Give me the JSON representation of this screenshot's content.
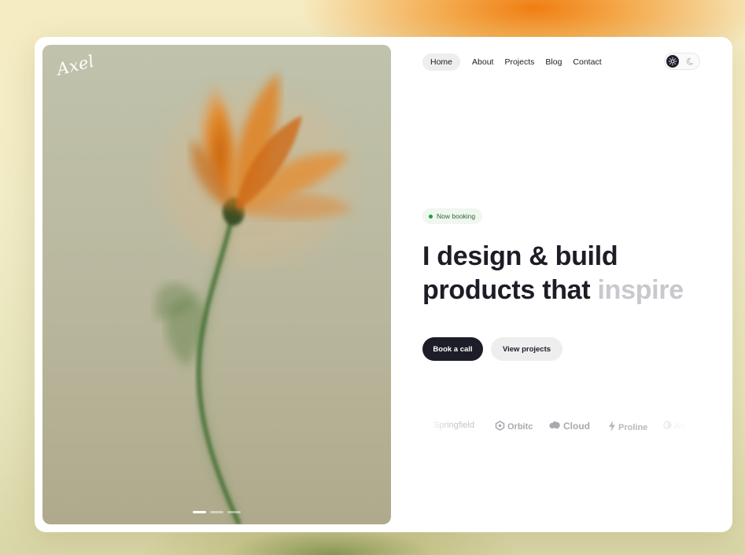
{
  "brand": {
    "logo_text": "Axel"
  },
  "nav": {
    "items": [
      {
        "label": "Home",
        "active": true
      },
      {
        "label": "About",
        "active": false
      },
      {
        "label": "Projects",
        "active": false
      },
      {
        "label": "Blog",
        "active": false
      },
      {
        "label": "Contact",
        "active": false
      }
    ]
  },
  "theme_toggle": {
    "selected": "light",
    "options": [
      "sun-icon",
      "moon-icon"
    ]
  },
  "status_badge": {
    "label": "Now booking",
    "color": "#1aa13a"
  },
  "hero": {
    "headline_line1": "I design & build",
    "headline_line2_dark": "products that",
    "headline_line2_muted": "inspire"
  },
  "actions": {
    "primary": "Book a call",
    "secondary": "View projects"
  },
  "client_logos": [
    {
      "name": "Springfield",
      "icon": ""
    },
    {
      "name": "Orbitc",
      "icon": "orbit-icon"
    },
    {
      "name": "Cloud",
      "icon": "cloud-icon"
    },
    {
      "name": "Proline",
      "icon": "bolt-icon"
    },
    {
      "name": "As",
      "icon": "half-circle-icon"
    }
  ],
  "carousel": {
    "slide_count": 3,
    "active_index": 0
  },
  "colors": {
    "accent_dark": "#1c1d29",
    "background_warm": "#f07d12",
    "status_green": "#1aa13a",
    "muted_text": "#c8c8ce"
  }
}
